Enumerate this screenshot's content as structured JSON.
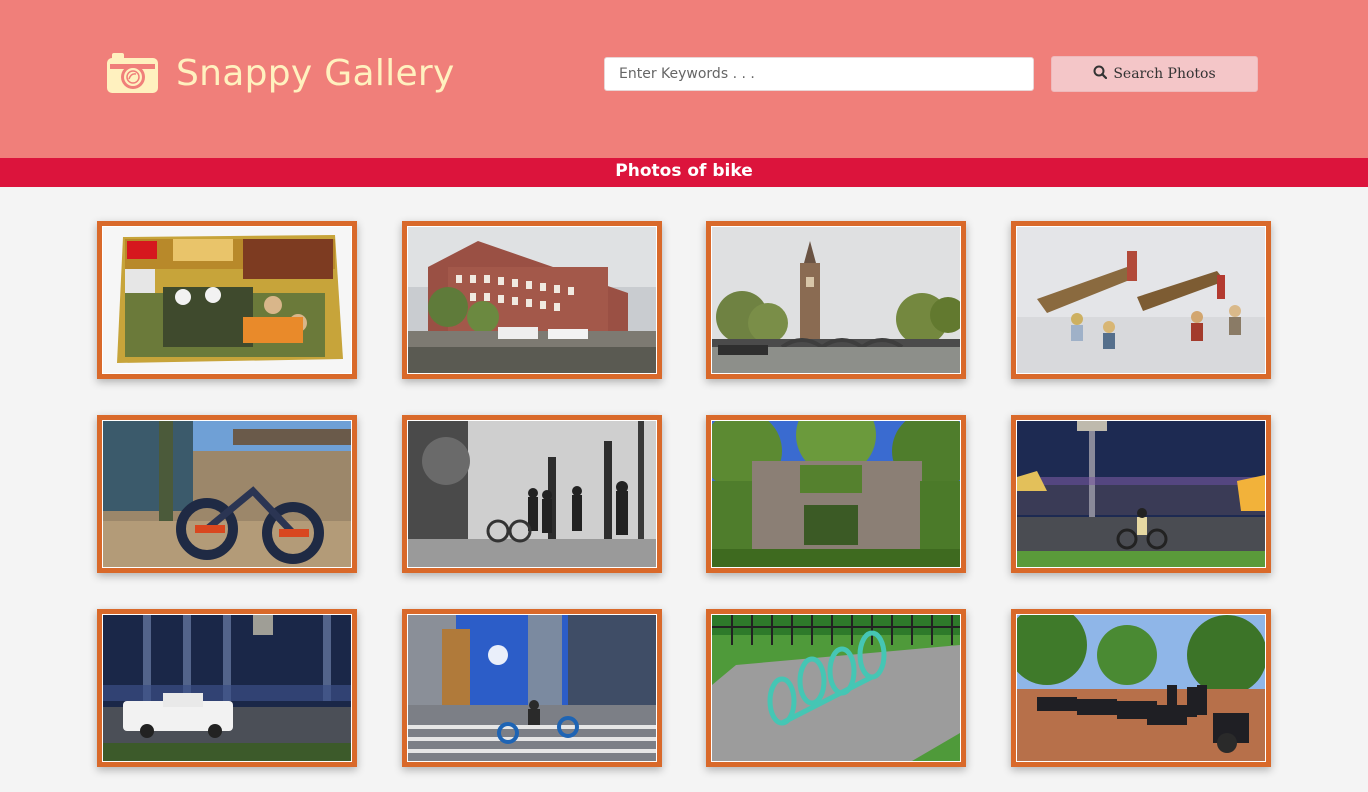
{
  "header": {
    "title": "Snappy Gallery",
    "logo_icon": "camera-icon",
    "background_color": "#f07f7a",
    "title_color": "#fff1bf"
  },
  "search": {
    "placeholder": "Enter Keywords . . .",
    "value": "",
    "button_label": "Search Photos",
    "button_icon": "search-icon"
  },
  "banner": {
    "label": "Photos of bike",
    "color": "#dc143c"
  },
  "gallery": {
    "frame_color": "#d9692a",
    "photos": [
      {
        "subject": "lego-star-wars-box"
      },
      {
        "subject": "amsterdam-canal-buildings"
      },
      {
        "subject": "amsterdam-church-tower-bridge"
      },
      {
        "subject": "lego-speeder-bikes"
      },
      {
        "subject": "graffiti-bike-sculpture"
      },
      {
        "subject": "bw-street-cyclists"
      },
      {
        "subject": "ivy-covered-ruin"
      },
      {
        "subject": "night-cyclist-motion-blur"
      },
      {
        "subject": "night-pickup-truck-blur"
      },
      {
        "subject": "city-cyclist-skyscrapers"
      },
      {
        "subject": "teal-spiral-bike-rack"
      },
      {
        "subject": "motorcycles-in-park"
      }
    ]
  }
}
